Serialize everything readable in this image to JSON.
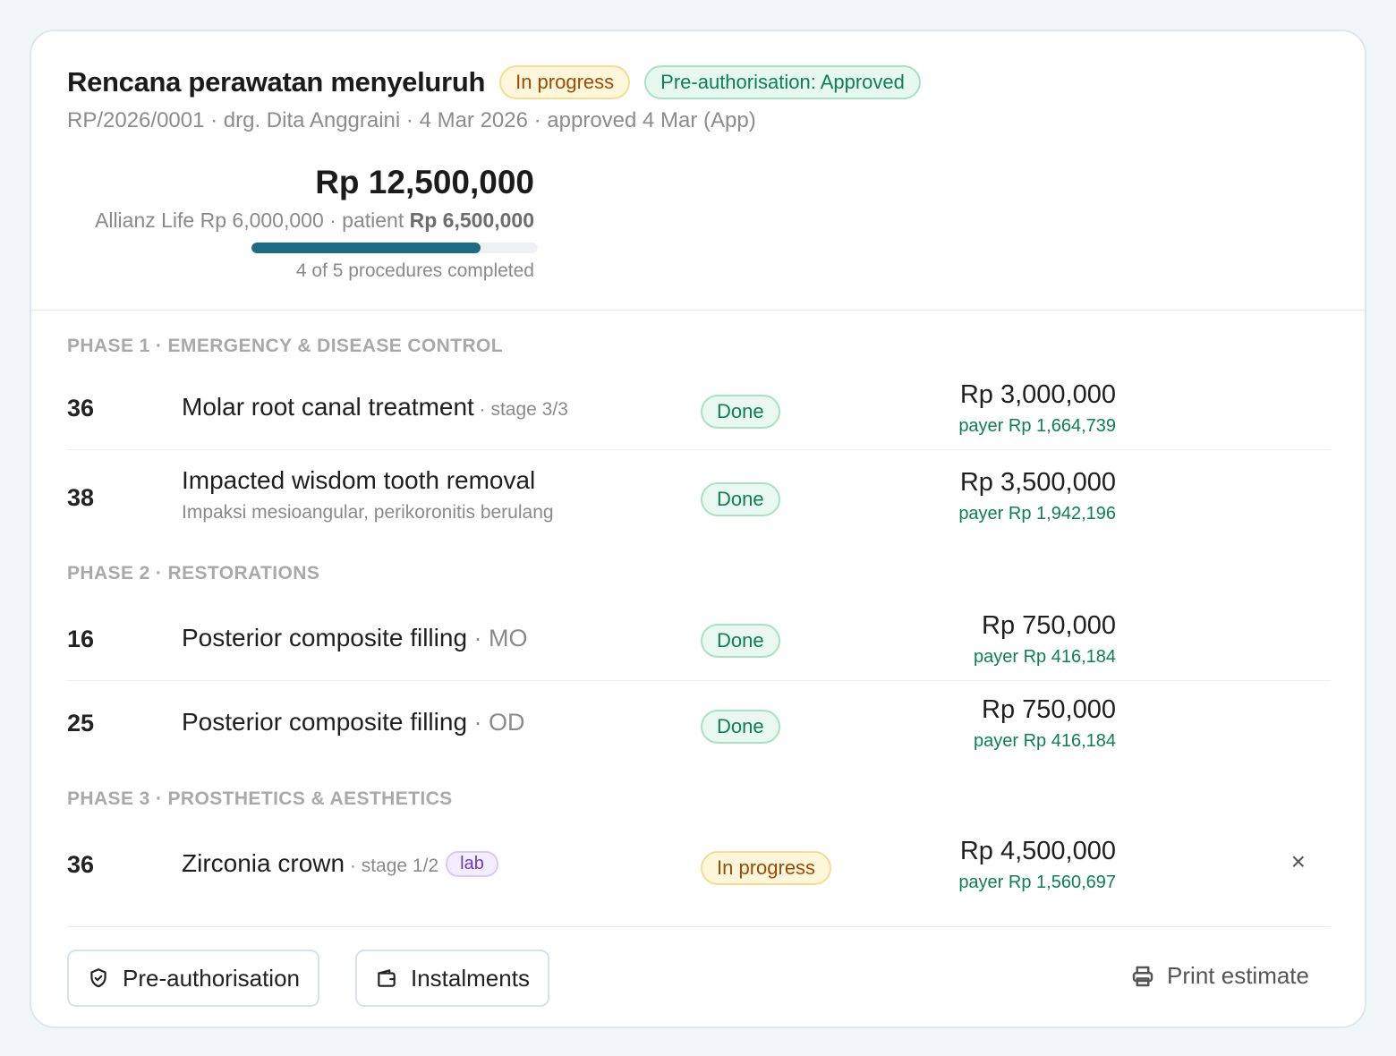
{
  "plan": {
    "title": "Rencana perawatan menyeluruh",
    "status_badge": "In progress",
    "preauth_badge": "Pre-authorisation: Approved",
    "meta": "RP/2026/0001 · drg. Dita Anggraini · 4 Mar 2026 · approved 4 Mar (App)",
    "total": "Rp 12,500,000",
    "split_payer": "Allianz Life Rp 6,000,000 · patient ",
    "split_patient": "Rp 6,500,000",
    "progress_fraction": 0.8,
    "progress_text": "4 of 5 procedures completed"
  },
  "phases": [
    {
      "label": "PHASE 1 · EMERGENCY & DISEASE CONTROL"
    },
    {
      "label": "PHASE 2 · RESTORATIONS"
    },
    {
      "label": "PHASE 3 · PROSTHETICS & AESTHETICS"
    }
  ],
  "procedures": [
    {
      "tooth": "36",
      "name": "Molar root canal treatment",
      "modifier": " · stage 3/3",
      "status": "Done",
      "price": "Rp 3,000,000",
      "payer": "payer Rp 1,664,739"
    },
    {
      "tooth": "38",
      "name": "Impacted wisdom tooth removal",
      "note": "Impaksi mesioangular, perikoronitis berulang",
      "status": "Done",
      "price": "Rp 3,500,000",
      "payer": "payer Rp 1,942,196"
    },
    {
      "tooth": "16",
      "name": "Posterior composite filling",
      "modifier": " · MO",
      "status": "Done",
      "price": "Rp 750,000",
      "payer": "payer Rp 416,184"
    },
    {
      "tooth": "25",
      "name": "Posterior composite filling",
      "modifier": " · OD",
      "status": "Done",
      "price": "Rp 750,000",
      "payer": "payer Rp 416,184"
    },
    {
      "tooth": "36",
      "name": "Zirconia crown",
      "modifier": " · stage 1/2",
      "tag": "lab",
      "status": "In progress",
      "price": "Rp 4,500,000",
      "payer": "payer Rp 1,560,697",
      "remove_icon": "×"
    }
  ],
  "actions": {
    "preauth": "Pre-authorisation",
    "instalments": "Instalments",
    "print": "Print estimate"
  },
  "colors": {
    "accent": "#1f6b85",
    "done": "#0b8054",
    "in_progress": "#a04a00",
    "lab": "#6a3bc8"
  },
  "icons": [
    "shield-check-icon",
    "wallet-icon",
    "printer-icon",
    "close-icon"
  ]
}
